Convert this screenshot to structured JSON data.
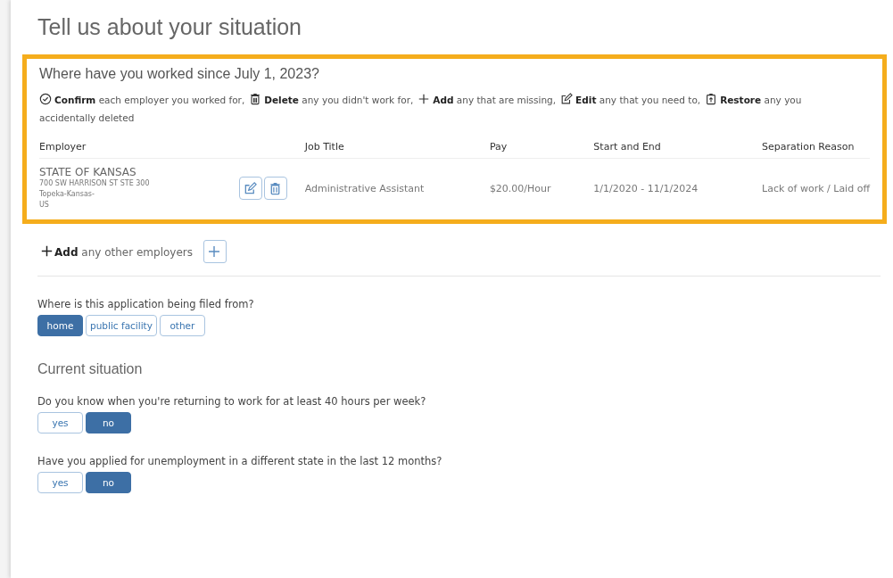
{
  "title": "Tell us about your situation",
  "employers": {
    "heading": "Where have you worked since July 1, 2023?",
    "instructions": [
      {
        "kind": "check",
        "text": "**Confirm** each employer you worked for,"
      },
      {
        "kind": "trash",
        "text": "**Delete** any you didn't work for,"
      },
      {
        "kind": "plus",
        "text": "**Add** any that are missing,"
      },
      {
        "kind": "edit",
        "text": "**Edit** any that you need to,"
      },
      {
        "kind": "restore",
        "text": "**Restore** any you"
      }
    ],
    "instructions_continued": "accidentally deleted",
    "columns": [
      "Employer",
      "Job Title",
      "Pay",
      "Start and End",
      "Separation Reason"
    ],
    "rows": [
      {
        "name": "STATE OF KANSAS",
        "address": [
          "700 SW HARRISON ST STE 300",
          "Topeka-Kansas-",
          "US"
        ],
        "job_title": "Administrative Assistant",
        "pay": "$20.00/Hour",
        "dates": "1/1/2020 - 11/1/2024",
        "reason": "Lack of work / Laid off"
      }
    ]
  },
  "add_employer": {
    "text": "**Add** any other employers"
  },
  "filed_from": {
    "label": "Where is this application being filed from?",
    "options": [
      {
        "label": "home",
        "selected": true
      },
      {
        "label": "public facility",
        "selected": false
      },
      {
        "label": "other",
        "selected": false
      }
    ]
  },
  "current_heading": "Current situation",
  "questions": [
    {
      "label": "Do you know when you're returning to work for at least 40 hours per week?",
      "options": [
        {
          "label": "yes",
          "selected": false
        },
        {
          "label": "no",
          "selected": true
        }
      ]
    },
    {
      "label": "Have you applied for unemployment in a different state in the last 12 months?",
      "options": [
        {
          "label": "yes",
          "selected": false
        },
        {
          "label": "no",
          "selected": true
        }
      ]
    }
  ]
}
